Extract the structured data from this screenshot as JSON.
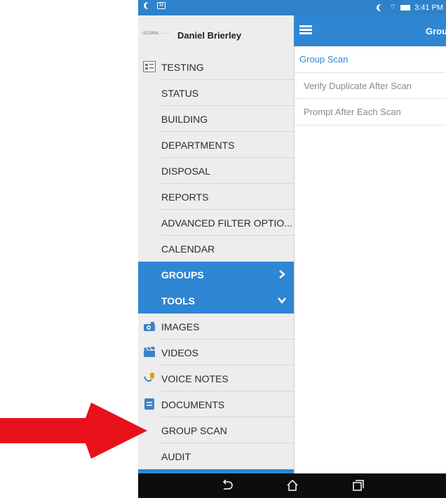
{
  "status_bar": {
    "time": "3:41 PM",
    "icons": [
      "moon-icon",
      "mail-icon",
      "wifi-icon",
      "battery-icon"
    ]
  },
  "drawer": {
    "logo_text": "UCONN ·······",
    "user_name": "Daniel Brierley",
    "items": [
      {
        "label": "TESTING",
        "icon": "list-icon"
      },
      {
        "label": "STATUS"
      },
      {
        "label": "BUILDING"
      },
      {
        "label": "DEPARTMENTS"
      },
      {
        "label": "DISPOSAL"
      },
      {
        "label": "REPORTS"
      },
      {
        "label": "ADVANCED FILTER OPTIO..."
      },
      {
        "label": "CALENDAR"
      },
      {
        "label": "GROUPS",
        "icon": "chevron-right-icon"
      },
      {
        "label": "TOOLS",
        "icon": "chevron-down-icon"
      },
      {
        "label": "IMAGES",
        "icon": "camera-icon"
      },
      {
        "label": "VIDEOS",
        "icon": "clapperboard-icon"
      },
      {
        "label": "VOICE NOTES",
        "icon": "microphone-icon"
      },
      {
        "label": "DOCUMENTS",
        "icon": "document-icon"
      },
      {
        "label": "GROUP SCAN"
      },
      {
        "label": "AUDIT"
      }
    ]
  },
  "main": {
    "title": "Grou",
    "section_header": "Group Scan",
    "settings": [
      {
        "label": "Verify Duplicate After Scan"
      },
      {
        "label": "Prompt After Each Scan"
      }
    ]
  },
  "nav_bar": {
    "icons": [
      "back-icon",
      "home-icon",
      "recents-icon"
    ]
  },
  "colors": {
    "accent": "#2f86d2",
    "drawer_bg": "#ededed",
    "arrow": "#e8111b"
  }
}
